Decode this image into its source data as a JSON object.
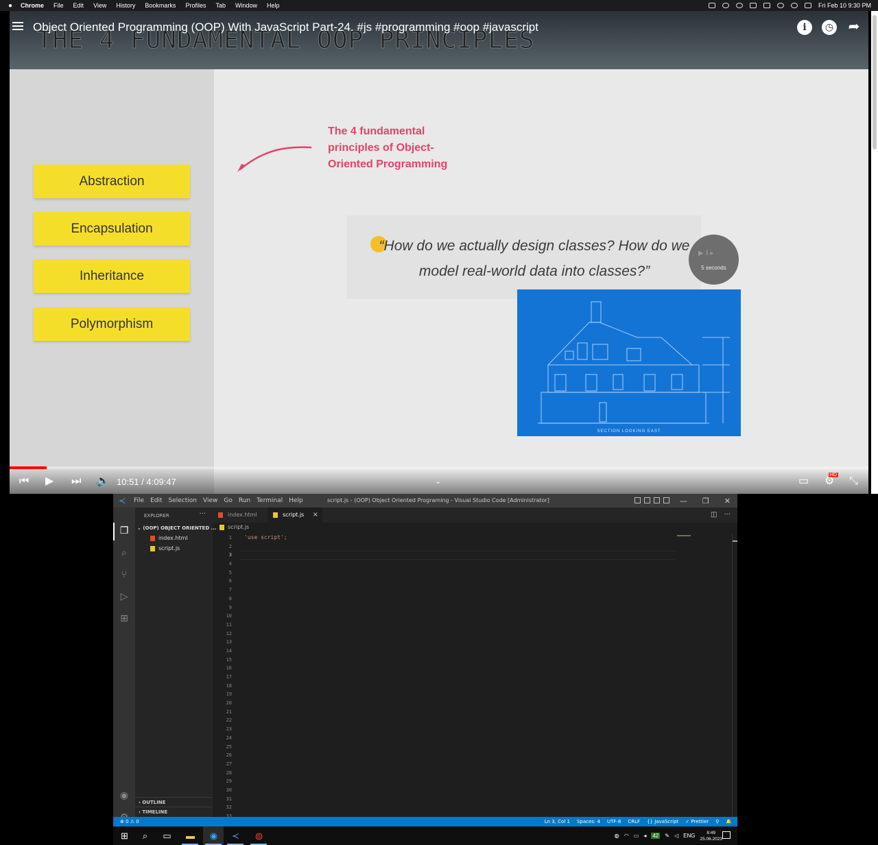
{
  "mac_menubar": {
    "apple": "",
    "app": "Chrome",
    "items": [
      "File",
      "Edit",
      "View",
      "History",
      "Bookmarks",
      "Profiles",
      "Tab",
      "Window",
      "Help"
    ],
    "datetime": "Fri Feb 10  9:30 PM"
  },
  "video": {
    "title": "Object Oriented Programming (OOP) With JavaScript Part-24. #js #programming #oop #javascript",
    "slide_heading": "THE 4 FUNDAMENTAL OOP PRINCIPLES",
    "principles": [
      "Abstraction",
      "Encapsulation",
      "Inheritance",
      "Polymorphism"
    ],
    "callout": "The 4 fundamental principles of Object-Oriented Programming",
    "quote": "“How do we actually design classes? How do we model real-world data into classes?”",
    "timer_label": "5 seconds",
    "blueprint_caption": "SECTION LOOKING EAST",
    "time": "10:51 / 4:09:47",
    "progress_fraction": 0.0434,
    "quality_badge": "HD",
    "info_icon": "i"
  },
  "vscode": {
    "menu": [
      "File",
      "Edit",
      "Selection",
      "View",
      "Go",
      "Run",
      "Terminal",
      "Help"
    ],
    "window_title": "script.js - (OOP) Object Oriented Programing - Visual Studio Code [Administrator]",
    "explorer_title": "EXPLORER",
    "explorer_more": "···",
    "folder": "(OOP) OBJECT ORIENTED ...",
    "files": [
      "index.html",
      "script.js"
    ],
    "outline": "OUTLINE",
    "timeline": "TIMELINE",
    "tabs": [
      {
        "label": "index.html",
        "active": false
      },
      {
        "label": "script.js",
        "active": true
      }
    ],
    "tab_close": "×",
    "breadcrumb": "script.js",
    "code_line1": "'use script';",
    "line_count": 33,
    "current_line": 3,
    "status_left": "⊗ 0 ⚠ 0",
    "status_right": [
      "Ln 3, Col 1",
      "Spaces: 4",
      "UTF-8",
      "CRLF",
      "{} JavaScript",
      "✓ Prettier"
    ]
  },
  "taskbar": {
    "lang": "ENG",
    "time": "8:49",
    "date": "25.06.2023",
    "badge": "42"
  },
  "colors": {
    "accent_red": "#e3436a",
    "principle_yellow": "#f5de2a",
    "vscode_blue": "#007acc",
    "blueprint_blue": "#1474d6"
  }
}
